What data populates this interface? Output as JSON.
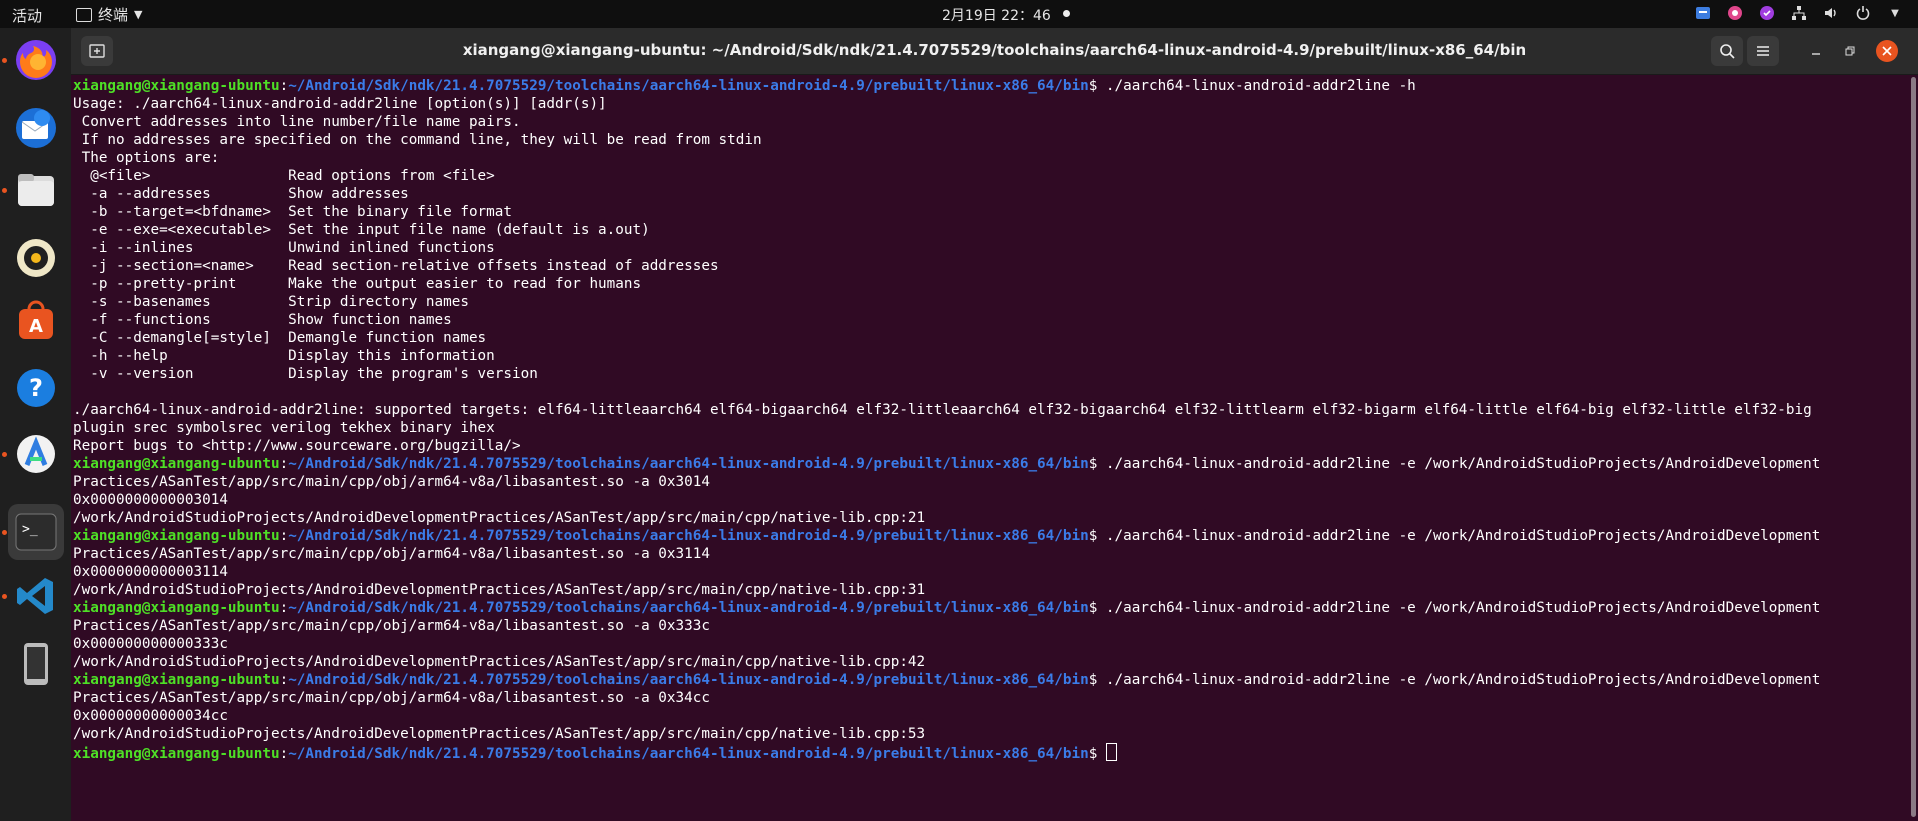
{
  "topbar": {
    "activities": "活动",
    "app_name": "终端",
    "clock": "2月19日  22：46"
  },
  "window": {
    "title": "xiangang@xiangang-ubuntu: ~/Android/Sdk/ndk/21.4.7075529/toolchains/aarch64-linux-android-4.9/prebuilt/linux-x86_64/bin"
  },
  "dock": {
    "items": [
      "firefox-icon",
      "thunderbird-icon",
      "files-icon",
      "rhythmbox-icon",
      "app-center-icon",
      "help-icon",
      "android-studio-icon",
      "terminal-icon",
      "vscode-icon",
      "device-icon"
    ]
  },
  "terminal": {
    "user": "xiangang@xiangang-ubuntu",
    "path": "~/Android/Sdk/ndk/21.4.7075529/toolchains/aarch64-linux-android-4.9/prebuilt/linux-x86_64/bin",
    "lines": [
      {
        "type": "prompt",
        "cmd": " ./aarch64-linux-android-addr2line -h"
      },
      {
        "type": "out",
        "text": "Usage: ./aarch64-linux-android-addr2line [option(s)] [addr(s)]"
      },
      {
        "type": "out",
        "text": " Convert addresses into line number/file name pairs."
      },
      {
        "type": "out",
        "text": " If no addresses are specified on the command line, they will be read from stdin"
      },
      {
        "type": "out",
        "text": " The options are:"
      },
      {
        "type": "out",
        "text": "  @<file>                Read options from <file>"
      },
      {
        "type": "out",
        "text": "  -a --addresses         Show addresses"
      },
      {
        "type": "out",
        "text": "  -b --target=<bfdname>  Set the binary file format"
      },
      {
        "type": "out",
        "text": "  -e --exe=<executable>  Set the input file name (default is a.out)"
      },
      {
        "type": "out",
        "text": "  -i --inlines           Unwind inlined functions"
      },
      {
        "type": "out",
        "text": "  -j --section=<name>    Read section-relative offsets instead of addresses"
      },
      {
        "type": "out",
        "text": "  -p --pretty-print      Make the output easier to read for humans"
      },
      {
        "type": "out",
        "text": "  -s --basenames         Strip directory names"
      },
      {
        "type": "out",
        "text": "  -f --functions         Show function names"
      },
      {
        "type": "out",
        "text": "  -C --demangle[=style]  Demangle function names"
      },
      {
        "type": "out",
        "text": "  -h --help              Display this information"
      },
      {
        "type": "out",
        "text": "  -v --version           Display the program's version"
      },
      {
        "type": "out",
        "text": ""
      },
      {
        "type": "out",
        "text": "./aarch64-linux-android-addr2line: supported targets: elf64-littleaarch64 elf64-bigaarch64 elf32-littleaarch64 elf32-bigaarch64 elf32-littlearm elf32-bigarm elf64-little elf64-big elf32-little elf32-big"
      },
      {
        "type": "out",
        "text": "plugin srec symbolsrec verilog tekhex binary ihex"
      },
      {
        "type": "out",
        "text": "Report bugs to <http://www.sourceware.org/bugzilla/>"
      },
      {
        "type": "prompt",
        "cmd": " ./aarch64-linux-android-addr2line -e /work/AndroidStudioProjects/AndroidDevelopment"
      },
      {
        "type": "out",
        "text": "Practices/ASanTest/app/src/main/cpp/obj/arm64-v8a/libasantest.so -a 0x3014"
      },
      {
        "type": "out",
        "text": "0x0000000000003014"
      },
      {
        "type": "out",
        "text": "/work/AndroidStudioProjects/AndroidDevelopmentPractices/ASanTest/app/src/main/cpp/native-lib.cpp:21"
      },
      {
        "type": "prompt",
        "cmd": " ./aarch64-linux-android-addr2line -e /work/AndroidStudioProjects/AndroidDevelopment"
      },
      {
        "type": "out",
        "text": "Practices/ASanTest/app/src/main/cpp/obj/arm64-v8a/libasantest.so -a 0x3114"
      },
      {
        "type": "out",
        "text": "0x0000000000003114"
      },
      {
        "type": "out",
        "text": "/work/AndroidStudioProjects/AndroidDevelopmentPractices/ASanTest/app/src/main/cpp/native-lib.cpp:31"
      },
      {
        "type": "prompt",
        "cmd": " ./aarch64-linux-android-addr2line -e /work/AndroidStudioProjects/AndroidDevelopment"
      },
      {
        "type": "out",
        "text": "Practices/ASanTest/app/src/main/cpp/obj/arm64-v8a/libasantest.so -a 0x333c"
      },
      {
        "type": "out",
        "text": "0x000000000000333c"
      },
      {
        "type": "out",
        "text": "/work/AndroidStudioProjects/AndroidDevelopmentPractices/ASanTest/app/src/main/cpp/native-lib.cpp:42"
      },
      {
        "type": "prompt",
        "cmd": " ./aarch64-linux-android-addr2line -e /work/AndroidStudioProjects/AndroidDevelopment"
      },
      {
        "type": "out",
        "text": "Practices/ASanTest/app/src/main/cpp/obj/arm64-v8a/libasantest.so -a 0x34cc"
      },
      {
        "type": "out",
        "text": "0x00000000000034cc"
      },
      {
        "type": "out",
        "text": "/work/AndroidStudioProjects/AndroidDevelopmentPractices/ASanTest/app/src/main/cpp/native-lib.cpp:53"
      },
      {
        "type": "prompt",
        "cmd": " ",
        "cursor": true
      }
    ]
  }
}
